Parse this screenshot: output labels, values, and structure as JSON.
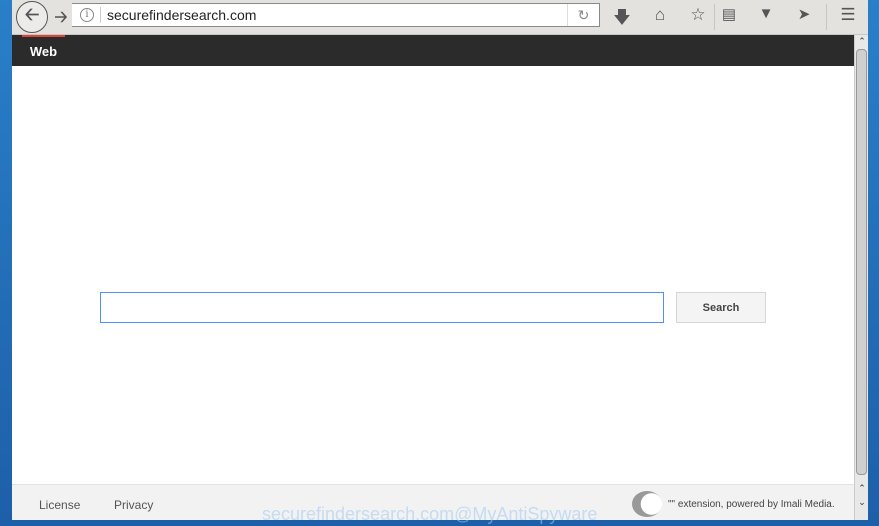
{
  "browser": {
    "url": "securefindersearch.com",
    "icons": [
      "back-icon",
      "forward-icon",
      "info-icon",
      "reload-icon",
      "download-icon",
      "home-icon",
      "bookmark-star-icon",
      "reading-list-icon",
      "pocket-icon",
      "send-icon",
      "menu-icon"
    ]
  },
  "nav": {
    "tab": "Web"
  },
  "search": {
    "value": "",
    "button": "Search"
  },
  "footer": {
    "license": "License",
    "privacy": "Privacy",
    "powered": "\"\" extension, powered by Imali Media."
  },
  "watermark": "securefindersearch.com@MyAntiSpyware",
  "colors": {
    "nav_bg": "#2b2b2b",
    "tab_accent": "#d9453b",
    "input_border": "#4d90fe"
  }
}
